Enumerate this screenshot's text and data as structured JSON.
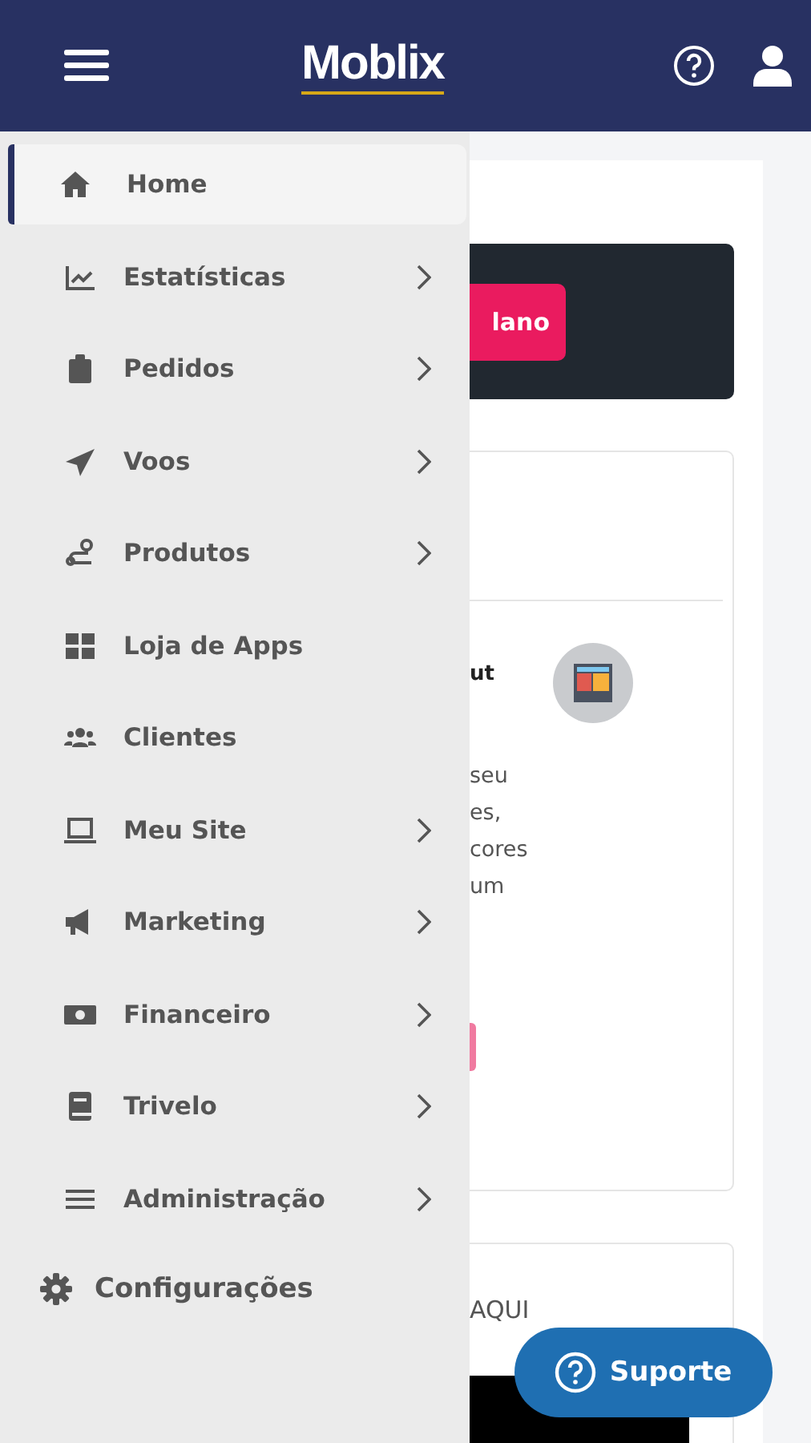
{
  "header": {
    "logo": "Moblix"
  },
  "menu": [
    {
      "kind": "item",
      "label": "Home",
      "selected": true,
      "submenu": false
    },
    {
      "kind": "item",
      "label": "Estatísticas",
      "selected": false,
      "submenu": true
    },
    {
      "kind": "item",
      "label": "Pedidos",
      "selected": false,
      "submenu": true
    },
    {
      "kind": "item",
      "label": "Voos",
      "selected": false,
      "submenu": true
    },
    {
      "kind": "item",
      "label": "Produtos",
      "selected": false,
      "submenu": true
    },
    {
      "kind": "item",
      "label": "Loja de Apps",
      "selected": false,
      "submenu": false
    },
    {
      "kind": "item",
      "label": "Clientes",
      "selected": false,
      "submenu": false
    },
    {
      "kind": "item",
      "label": "Meu Site",
      "selected": false,
      "submenu": true
    },
    {
      "kind": "item",
      "label": "Marketing",
      "selected": false,
      "submenu": true
    },
    {
      "kind": "item",
      "label": "Financeiro",
      "selected": false,
      "submenu": true
    },
    {
      "kind": "item",
      "label": "Trivelo",
      "selected": false,
      "submenu": true
    },
    {
      "kind": "item",
      "label": "Administração",
      "selected": false,
      "submenu": true
    },
    {
      "kind": "section",
      "label": "Configurações",
      "selected": false
    }
  ],
  "banner": {
    "button": "lano"
  },
  "card": {
    "title": "ut",
    "lines": [
      "seu",
      "es,",
      "cores",
      "um"
    ]
  },
  "card2": {
    "text": "AQUI"
  },
  "support": {
    "label": "Suporte"
  }
}
